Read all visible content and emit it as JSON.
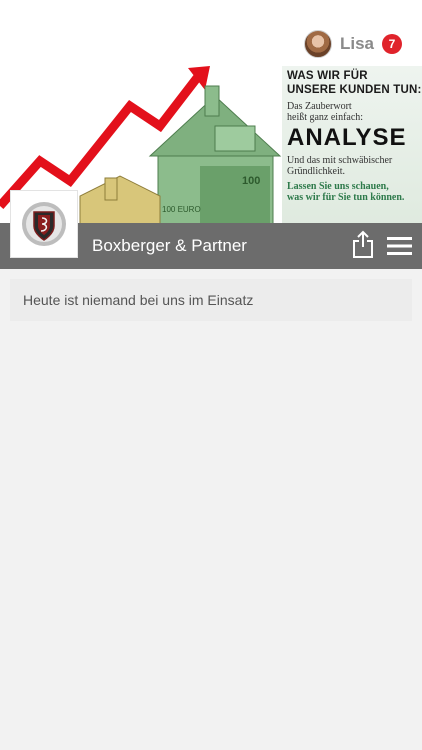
{
  "user": {
    "name": "Lisa",
    "notification_count": "7"
  },
  "banner": {
    "heading": "WAS WIR FÜR\nUNSERE KUNDEN TUN:",
    "text1": "Das Zauberwort\nheißt ganz einfach:",
    "big": "ANALYSE",
    "text2": "Und das mit schwäbischer\nGründlichkeit.",
    "cta": "Lassen Sie uns schauen,\nwas wir für Sie tun können."
  },
  "page": {
    "title": "Boxberger & Partner"
  },
  "content": {
    "notice": "Heute ist niemand bei uns im Einsatz"
  },
  "colors": {
    "badge": "#e0232b",
    "title_bar": "#6c6c6c",
    "arrow": "#e3101b",
    "banknote": "#6aa06a"
  },
  "icons": [
    "avatar",
    "share-icon",
    "hamburger-menu-icon",
    "company-logo"
  ]
}
